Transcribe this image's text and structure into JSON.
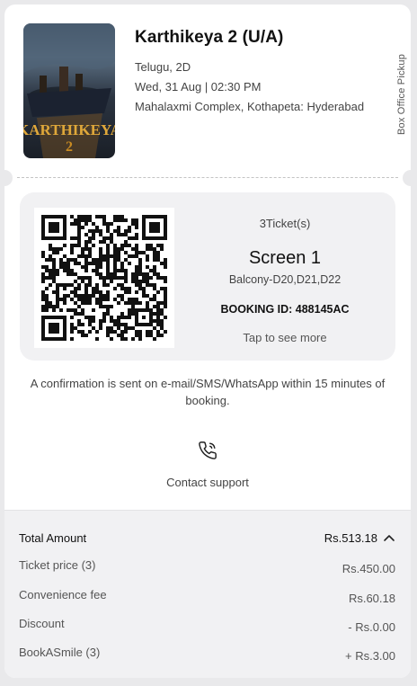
{
  "movie": {
    "title": "Karthikeya 2 (U/A)",
    "language_format": "Telugu, 2D",
    "datetime": "Wed, 31 Aug | 02:30 PM",
    "venue": "Mahalaxmi Complex, Kothapeta: Hyderabad",
    "poster_text": "2"
  },
  "side_label": "Box Office Pickup",
  "ticket": {
    "count_label": "3Ticket(s)",
    "screen": "Screen 1",
    "seats": "Balcony-D20,D21,D22",
    "booking_id_label": "BOOKING ID: 488145AC",
    "tap_more": "Tap to see more"
  },
  "confirmation_text": "A confirmation is sent on e-mail/SMS/WhatsApp within 15 minutes of booking.",
  "support": {
    "icon": "phone-icon",
    "label": "Contact support"
  },
  "summary": {
    "total_label": "Total Amount",
    "total_value": "Rs.513.18",
    "items": [
      {
        "label": "Ticket price (3)",
        "value": "Rs.450.00"
      },
      {
        "label": "Convenience fee",
        "value": "Rs.60.18"
      },
      {
        "label": "Discount",
        "value": "- Rs.0.00"
      },
      {
        "label": "BookASmile (3)",
        "value": "+ Rs.3.00"
      }
    ]
  },
  "colors": {
    "background": "#e9e9eb",
    "card": "#ffffff",
    "panel": "#f1f1f3",
    "text_primary": "#111111",
    "text_secondary": "#444444"
  }
}
